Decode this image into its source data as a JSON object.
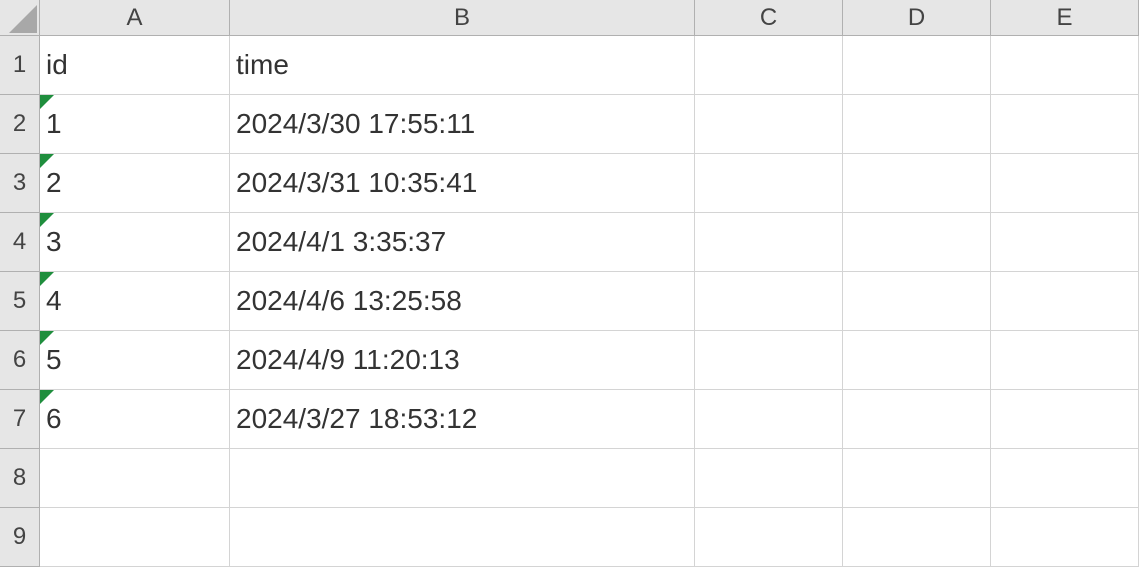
{
  "columns": [
    "A",
    "B",
    "C",
    "D",
    "E"
  ],
  "rows": [
    "1",
    "2",
    "3",
    "4",
    "5",
    "6",
    "7",
    "8",
    "9"
  ],
  "cells": {
    "A1": "id",
    "B1": "time",
    "A2": "1",
    "B2": "2024/3/30  17:55:11",
    "A3": "2",
    "B3": "2024/3/31  10:35:41",
    "A4": "3",
    "B4": "2024/4/1  3:35:37",
    "A5": "4",
    "B5": "2024/4/6  13:25:58",
    "A6": "5",
    "B6": "2024/4/9  11:20:13",
    "A7": "6",
    "B7": "2024/3/27  18:53:12"
  },
  "numberAsTextCells": [
    "A2",
    "A3",
    "A4",
    "A5",
    "A6",
    "A7"
  ]
}
